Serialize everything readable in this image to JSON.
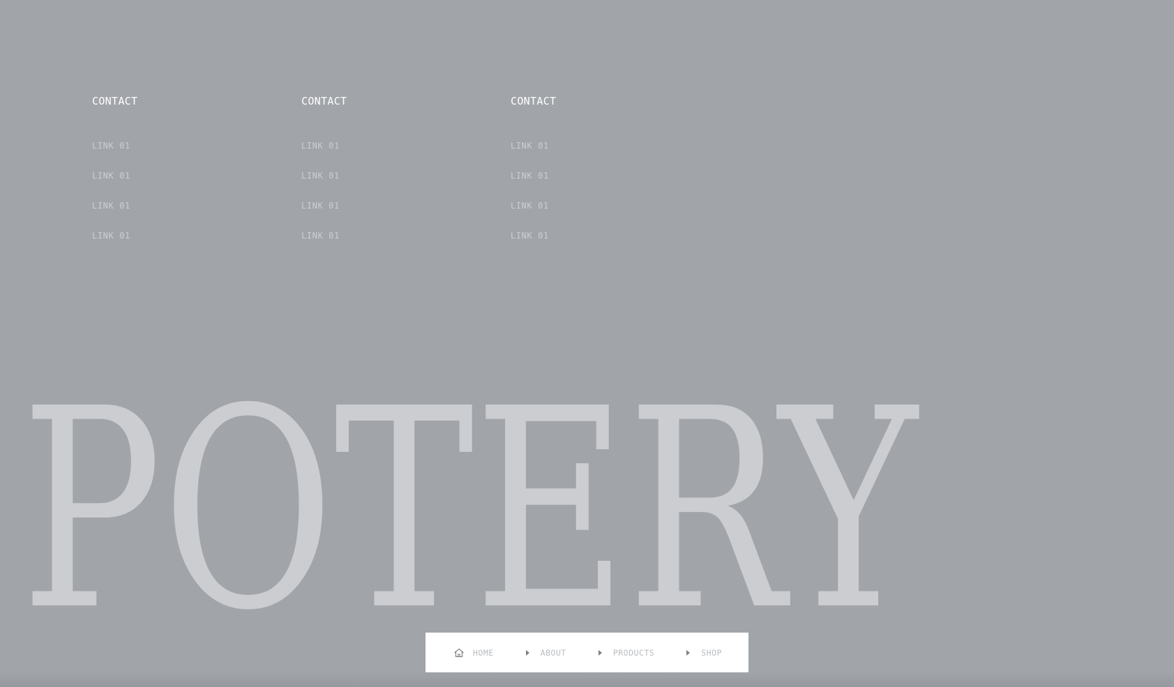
{
  "footer": {
    "columns": [
      {
        "heading": "CONTACT",
        "links": [
          "LINK 01",
          "LINK 01",
          "LINK 01",
          "LINK 01"
        ]
      },
      {
        "heading": "CONTACT",
        "links": [
          "LINK 01",
          "LINK 01",
          "LINK 01",
          "LINK 01"
        ]
      },
      {
        "heading": "CONTACT",
        "links": [
          "LINK 01",
          "LINK 01",
          "LINK 01",
          "LINK 01"
        ]
      }
    ]
  },
  "brand": {
    "wordmark": "POTERY"
  },
  "breadcrumb": {
    "home": "HOME",
    "about": "ABOUT",
    "products": "PRODUCTS",
    "shop": "SHOP",
    "home_icon": "home-icon",
    "separator_icon": "caret-right-icon"
  },
  "colors": {
    "background": "#a1a4a8",
    "heading": "#ffffff",
    "link": "#cdcfd2",
    "wordmark": "#cbcdd0",
    "breadcrumb_bg": "#ffffff",
    "breadcrumb_text": "#b9bcc0"
  }
}
